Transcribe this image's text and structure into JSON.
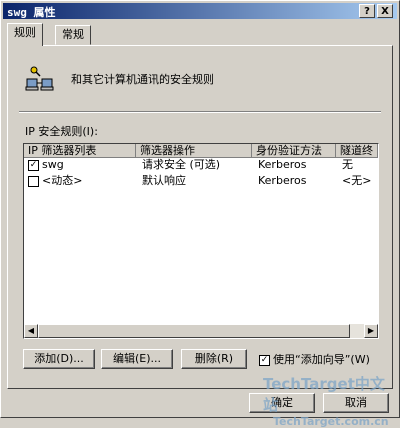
{
  "window": {
    "title": "swg 属性",
    "help_label": "?",
    "close_label": "X"
  },
  "tabs": [
    {
      "label": "规则"
    },
    {
      "label": "常规"
    }
  ],
  "header": {
    "description": "和其它计算机通讯的安全规则",
    "icon": "network-computers-icon"
  },
  "rules": {
    "label": "IP 安全规则(I):",
    "columns": [
      "IP 筛选器列表",
      "筛选器操作",
      "身份验证方法",
      "隧道终"
    ],
    "rows": [
      {
        "checked": true,
        "check_glyph": "✓",
        "filter_list": "swg",
        "filter_action": "请求安全 (可选)",
        "auth": "Kerberos",
        "tunnel": "无"
      },
      {
        "checked": false,
        "check_glyph": "",
        "filter_list": "<动态>",
        "filter_action": "默认响应",
        "auth": "Kerberos",
        "tunnel": "<无>"
      }
    ]
  },
  "buttons": {
    "add": "添加(D)...",
    "edit": "编辑(E)...",
    "remove": "删除(R)",
    "ok": "确定",
    "cancel": "取消"
  },
  "wizard": {
    "checked": true,
    "check_glyph": "✓",
    "label": "使用“添加向导”(W)"
  },
  "watermark": {
    "text": "TechTarget中文站",
    "subtext": "TechTarget.com.cn"
  }
}
